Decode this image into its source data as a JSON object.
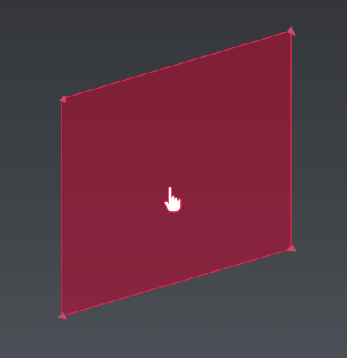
{
  "viewport": {
    "background_top": "#34363a",
    "background_bottom": "#4b5056"
  },
  "face": {
    "fill_color": "#852039",
    "edge_color": "#d8284f",
    "vertex_color": "#c94a6a",
    "selected": true
  },
  "cursor": {
    "icon": "hand-pointer-icon",
    "fill_color": "#ffffff",
    "outline_color": "#d8284f"
  }
}
